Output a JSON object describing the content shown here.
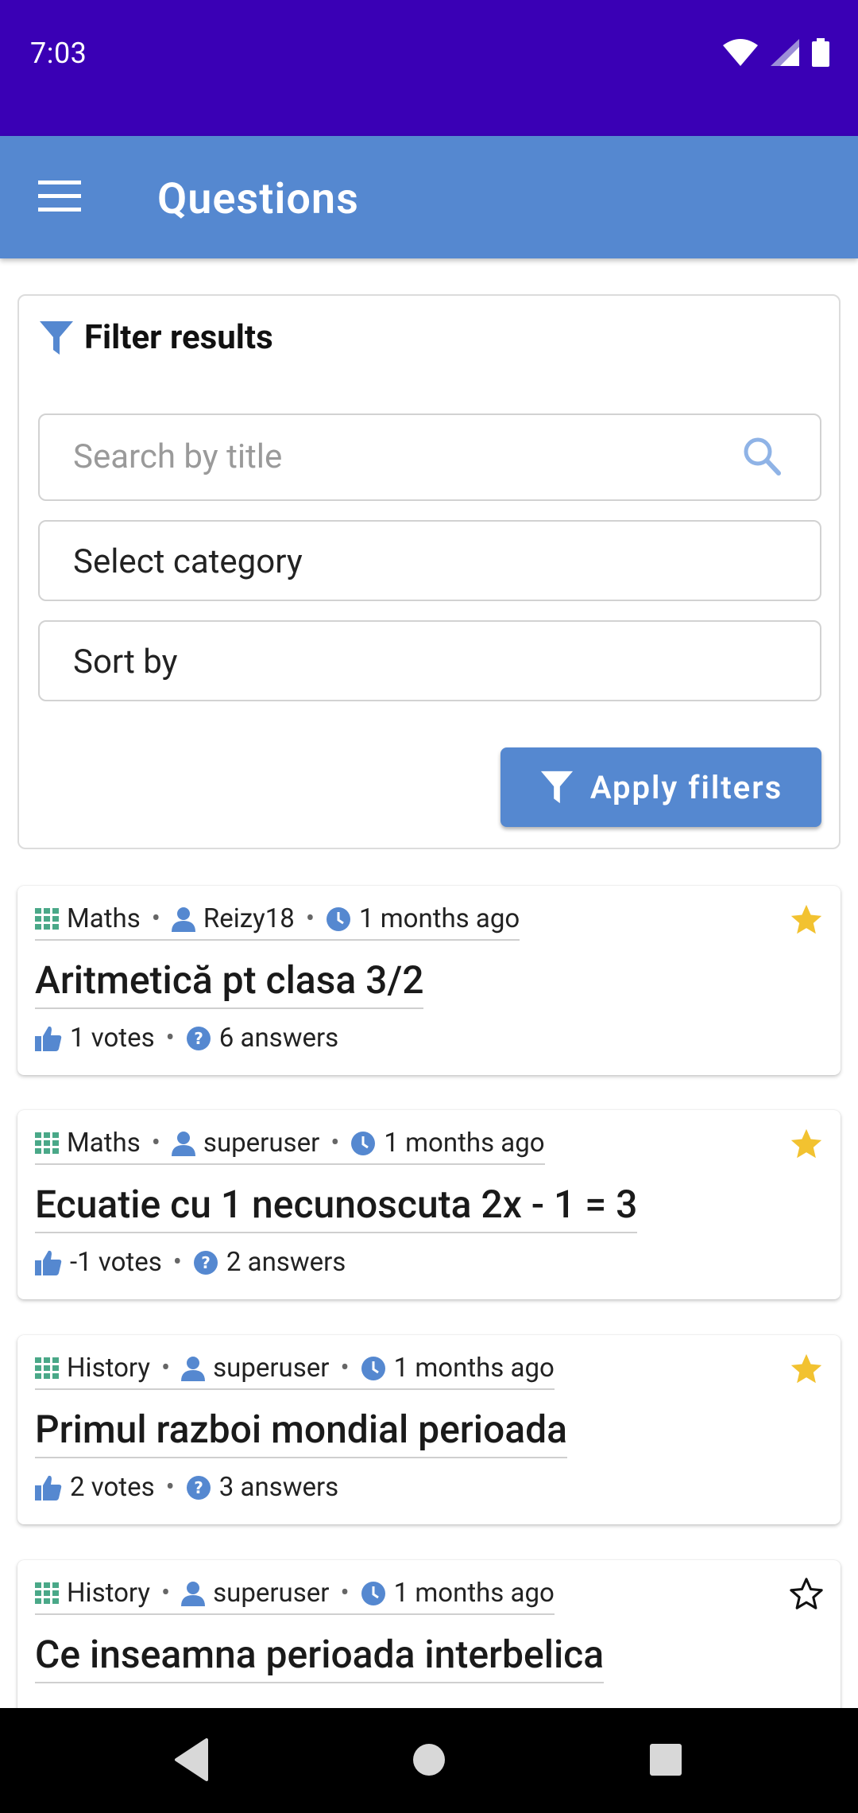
{
  "status_bar": {
    "time": "7:03"
  },
  "app_bar": {
    "title": "Questions"
  },
  "filter": {
    "heading": "Filter results",
    "search_placeholder": "Search by title",
    "category_label": "Select category",
    "sort_label": "Sort by",
    "apply_label": "Apply filters"
  },
  "questions": [
    {
      "category": "Maths",
      "author": "Reizy18",
      "time": "1 months ago",
      "title": "Aritmetică pt clasa 3/2",
      "votes": "1 votes",
      "answers": "6 answers",
      "favorite": true
    },
    {
      "category": "Maths",
      "author": "superuser",
      "time": "1 months ago",
      "title": "Ecuatie cu 1 necunoscuta 2x - 1 = 3",
      "votes": "-1 votes",
      "answers": "2 answers",
      "favorite": true
    },
    {
      "category": "History",
      "author": "superuser",
      "time": "1 months ago",
      "title": "Primul razboi mondial perioada",
      "votes": "2 votes",
      "answers": "3 answers",
      "favorite": true
    },
    {
      "category": "History",
      "author": "superuser",
      "time": "1 months ago",
      "title": "Ce inseamna perioada interbelica",
      "votes": "",
      "answers": "",
      "favorite": false
    }
  ],
  "colors": {
    "status_bar": "#3a00b5",
    "app_bar": "#5588d0",
    "accent": "#5588d0",
    "star": "#f2c230",
    "category_icon": "#4aa888"
  }
}
